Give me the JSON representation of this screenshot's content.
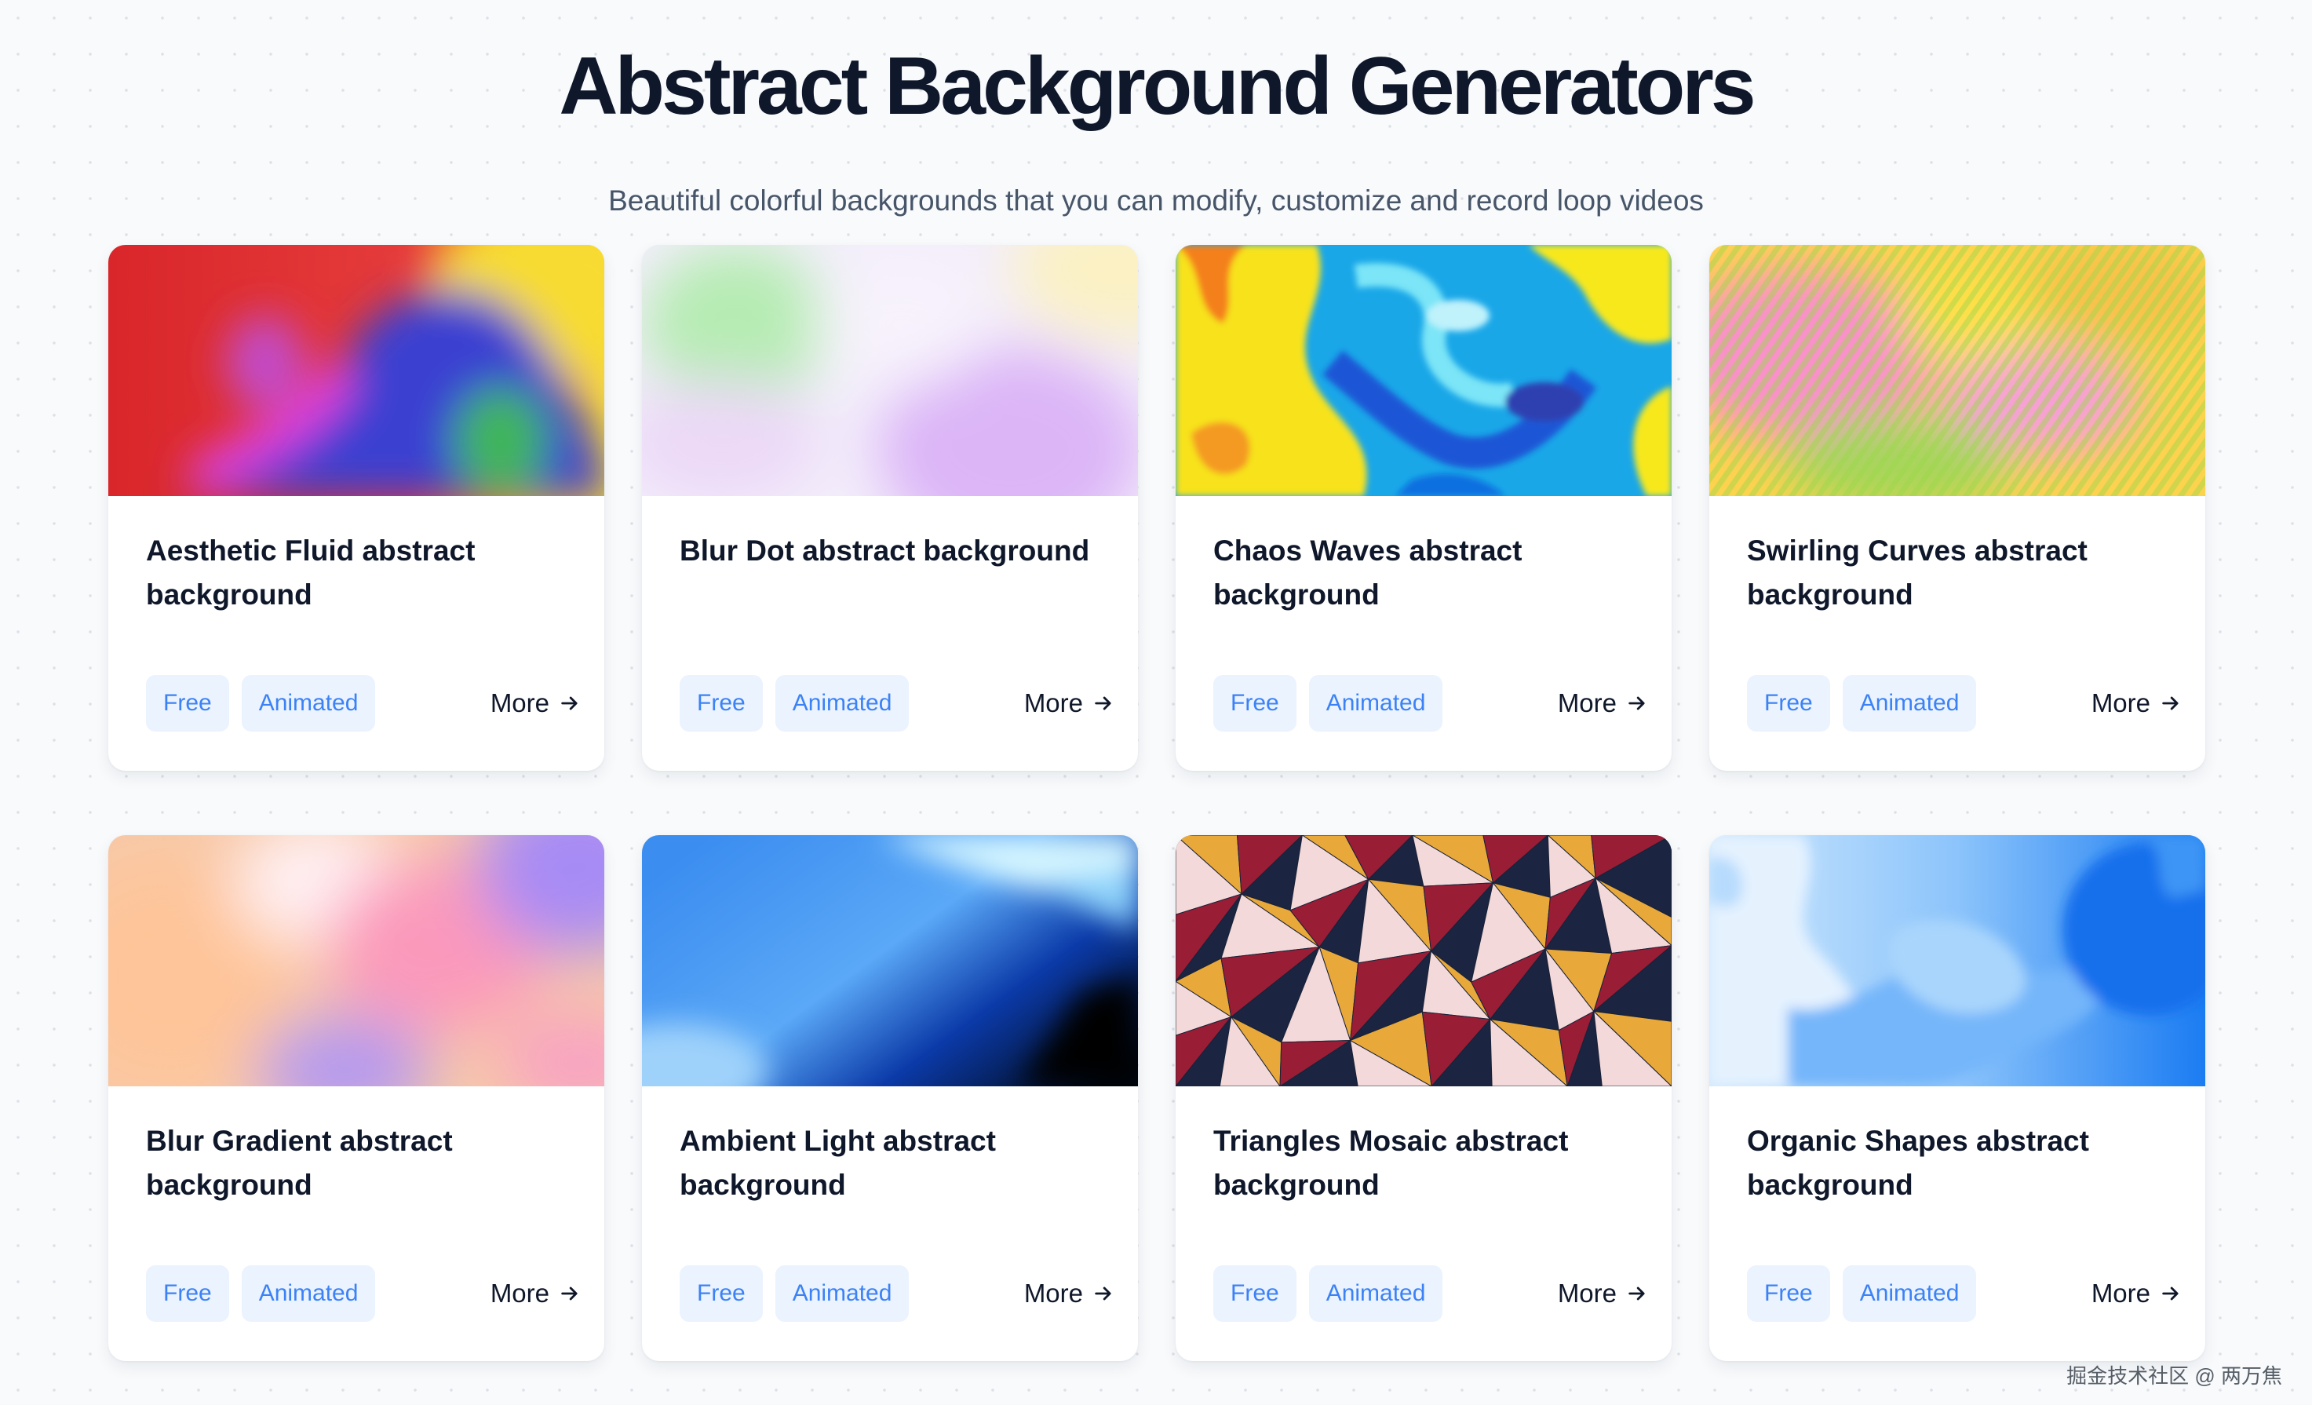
{
  "page": {
    "title": "Abstract Background Generators",
    "subtitle": "Beautiful colorful backgrounds that you can modify, customize and record loop videos"
  },
  "cards": [
    {
      "title": "Aesthetic Fluid abstract background",
      "tags": [
        "Free",
        "Animated"
      ],
      "more_label": "More",
      "thumbnail": "aesthetic-fluid"
    },
    {
      "title": "Blur Dot abstract background",
      "tags": [
        "Free",
        "Animated"
      ],
      "more_label": "More",
      "thumbnail": "blur-dot"
    },
    {
      "title": "Chaos Waves abstract background",
      "tags": [
        "Free",
        "Animated"
      ],
      "more_label": "More",
      "thumbnail": "chaos-waves"
    },
    {
      "title": "Swirling Curves abstract background",
      "tags": [
        "Free",
        "Animated"
      ],
      "more_label": "More",
      "thumbnail": "swirling-curves"
    },
    {
      "title": "Blur Gradient abstract background",
      "tags": [
        "Free",
        "Animated"
      ],
      "more_label": "More",
      "thumbnail": "blur-gradient"
    },
    {
      "title": "Ambient Light abstract background",
      "tags": [
        "Free",
        "Animated"
      ],
      "more_label": "More",
      "thumbnail": "ambient-light"
    },
    {
      "title": "Triangles Mosaic abstract background",
      "tags": [
        "Free",
        "Animated"
      ],
      "more_label": "More",
      "thumbnail": "triangles-mosaic"
    },
    {
      "title": "Organic Shapes abstract background",
      "tags": [
        "Free",
        "Animated"
      ],
      "more_label": "More",
      "thumbnail": "organic-shapes"
    }
  ],
  "icons": {
    "more": "arrow-right-icon"
  },
  "colors": {
    "tag_background": "#ebf3fe",
    "tag_text": "#3b82f6",
    "title_text": "#0f172a",
    "subtitle_text": "#475569",
    "page_background": "#f8fafc"
  },
  "watermark": "掘金技术社区 @ 两万焦"
}
